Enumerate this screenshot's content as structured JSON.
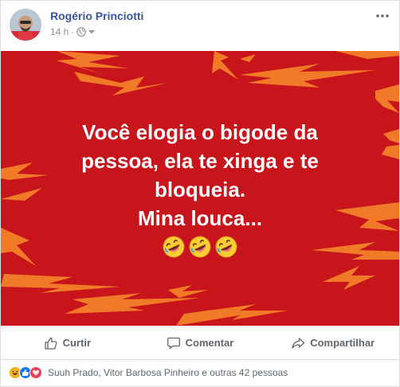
{
  "post": {
    "author": "Rogério Princiotti",
    "time": "14 h",
    "separator": "·",
    "privacy_icon": "globe-icon",
    "menu_icon": "more-horizontal-icon",
    "image": {
      "line1": "Você elogia o bigode da",
      "line2": "pessoa, ela te xinga e te",
      "line3": "bloqueia.",
      "line4": "Mina louca...",
      "emojis": [
        "rolling-on-floor-laughing-icon",
        "rolling-on-floor-laughing-icon",
        "rolling-on-floor-laughing-icon"
      ],
      "background_color": "#c8141b",
      "bolt_color": "#f07a28"
    }
  },
  "actions": {
    "like": "Curtir",
    "comment": "Comentar",
    "share": "Compartilhar"
  },
  "reactions": {
    "icons": [
      "haha-icon",
      "like-icon",
      "love-icon"
    ],
    "summary": "Suuh Prado, Vitor Barbosa Pinheiro e outras 42 pessoas"
  },
  "colors": {
    "author_link": "#385898",
    "muted_text": "#606770",
    "like_blue": "#1877f2",
    "love_red": "#f33e58",
    "haha_yellow": "#f7b125"
  }
}
